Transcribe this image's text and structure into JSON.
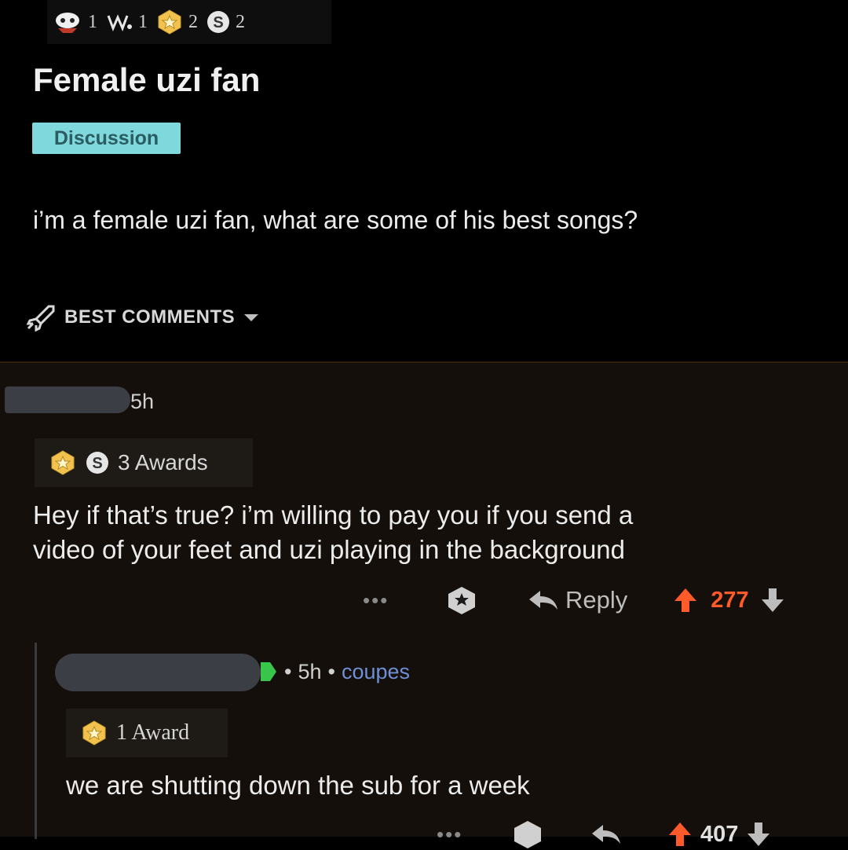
{
  "post": {
    "awards": [
      {
        "icon": "helpful-award-icon",
        "count": "1"
      },
      {
        "icon": "wholesome-award-icon",
        "count": "1"
      },
      {
        "icon": "gold-star-award-icon",
        "count": "2"
      },
      {
        "icon": "silver-s-award-icon",
        "count": "2"
      }
    ],
    "title": "Female uzi fan",
    "flair": "Discussion",
    "body": "i’m a female uzi fan, what are some of his best songs?"
  },
  "sort": {
    "label": "BEST COMMENTS"
  },
  "comments": [
    {
      "time": "5h",
      "awards_label": "3 Awards",
      "text_line1": "Hey if that’s true? i’m willing to pay you if you send a",
      "text_line2": "video of your feet and uzi playing in the background",
      "more": "•••",
      "reply": "Reply",
      "score": "277"
    },
    {
      "separator1": "•",
      "time": "5h",
      "separator2": "•",
      "user_flair": "coupes",
      "awards_label": "1 Award",
      "text": "we are shutting down the sub for a week",
      "more": "•••",
      "score": "407"
    }
  ],
  "colors": {
    "upvote": "#ff5a2a",
    "flair_bg": "#7fd8dc",
    "mod_green": "#39c44a",
    "user_flair": "#6f8fd6"
  }
}
